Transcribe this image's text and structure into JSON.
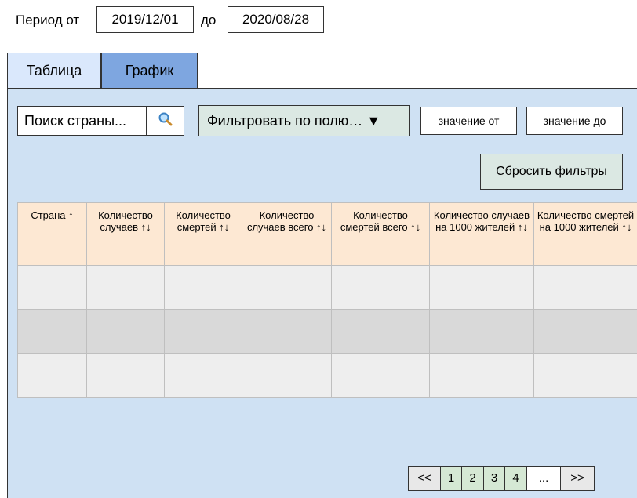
{
  "period": {
    "label_from": "Период от",
    "date_from": "2019/12/01",
    "label_to": "до",
    "date_to": "2020/08/28"
  },
  "tabs": [
    {
      "label": "Таблица",
      "active": false
    },
    {
      "label": "График",
      "active": true
    }
  ],
  "filters": {
    "search_placeholder": "Поиск страны...",
    "search_icon": "search-icon",
    "field_filter_label": "Фильтровать по полю… ▼",
    "value_from_placeholder": "значение от",
    "value_to_placeholder": "значение до",
    "reset_label": "Сбросить фильтры"
  },
  "table": {
    "columns": [
      "Страна ↑",
      "Количество случаев ↑↓",
      "Количество смертей ↑↓",
      "Количество случаев всего ↑↓",
      "Количество смертей всего ↑↓",
      "Количество случаев на 1000 жителей ↑↓",
      "Количество смертей на 1000 жителей ↑↓"
    ],
    "rows": [
      [
        "",
        "",
        "",
        "",
        "",
        "",
        ""
      ],
      [
        "",
        "",
        "",
        "",
        "",
        "",
        ""
      ],
      [
        "",
        "",
        "",
        "",
        "",
        "",
        ""
      ]
    ]
  },
  "pagination": {
    "prev": "<<",
    "pages": [
      "1",
      "2",
      "3",
      "4"
    ],
    "ellipsis": "...",
    "next": ">>"
  },
  "colors": {
    "panel_bg": "#cfe1f3",
    "active_tab": "#7ea6e0",
    "inactive_tab": "#dae8fc",
    "header_bg": "#fde8d3",
    "page_num_bg": "#d5e8d4"
  }
}
